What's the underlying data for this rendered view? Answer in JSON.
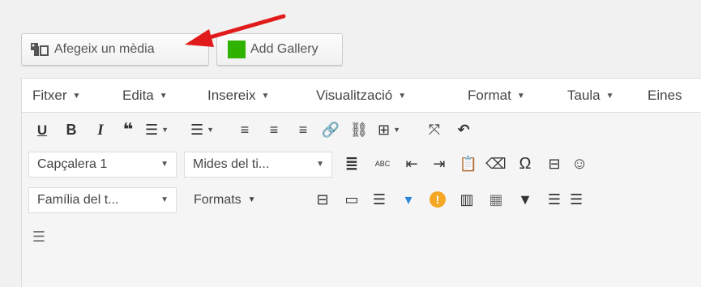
{
  "buttons": {
    "add_media": "Afegeix un mèdia",
    "add_gallery": "Add Gallery"
  },
  "menubar": {
    "items": [
      {
        "label": "Fitxer"
      },
      {
        "label": "Edita"
      },
      {
        "label": "Insereix"
      },
      {
        "label": "Visualització"
      },
      {
        "label": "Format"
      },
      {
        "label": "Taula"
      },
      {
        "label": "Eines"
      }
    ]
  },
  "toolbar1": {
    "underline": "U",
    "bold": "B",
    "italic": "I",
    "blockquote": "❝",
    "bullist": "☰",
    "numlist": "☰",
    "align_left": "≡",
    "align_center": "≡",
    "align_right": "≡",
    "link": "🔗",
    "unlink": "⛓",
    "table": "⊞",
    "fullscreen": "⤧",
    "undo": "↶"
  },
  "toolbar2": {
    "heading_select": "Capçalera 1",
    "font_size_select": "Mides del ti...",
    "justify": "≣",
    "abc": "ABC",
    "outdent": "⇤",
    "indent": "⇥",
    "paste": "📋",
    "eraser": "⌫",
    "omega": "Ω",
    "hr": "⊟",
    "emoticon": "☺"
  },
  "toolbar3": {
    "font_family_select": "Família del t...",
    "formats": "Formats",
    "template": "⊟",
    "media": "▭",
    "list": "☰",
    "color": "▾",
    "warning": "!",
    "columns": "▥",
    "grid": "▦",
    "comment": "▼",
    "sort": "☰",
    "more": "☰"
  },
  "toolbar4": {
    "kitchen_sink": "☰"
  },
  "colors": {
    "accent_arrow": "#e11b1b",
    "gallery_green": "#2fb300",
    "color_tool_blue": "#2b87da",
    "warning_orange": "#f5a623"
  }
}
